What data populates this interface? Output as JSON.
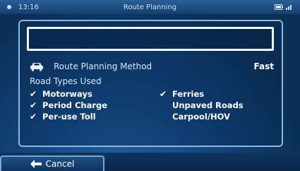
{
  "statusbar": {
    "time": "13:16",
    "title": "Route Planning",
    "battery_icon": "battery-icon",
    "signal_icon": "signal-icon"
  },
  "search": {
    "value": ""
  },
  "method": {
    "label": "Route Planning Method",
    "value": "Fast",
    "icon": "car-icon"
  },
  "types": {
    "label": "Road Types Used",
    "options": [
      {
        "label": "Motorways",
        "checked": true
      },
      {
        "label": "Period Charge",
        "checked": true
      },
      {
        "label": "Per-use Toll",
        "checked": true
      },
      {
        "label": "Ferries",
        "checked": true
      },
      {
        "label": "Unpaved Roads",
        "checked": false
      },
      {
        "label": "Carpool/HOV",
        "checked": false
      }
    ]
  },
  "footer": {
    "cancel_label": "Cancel",
    "cancel_icon": "arrow-left-icon"
  }
}
